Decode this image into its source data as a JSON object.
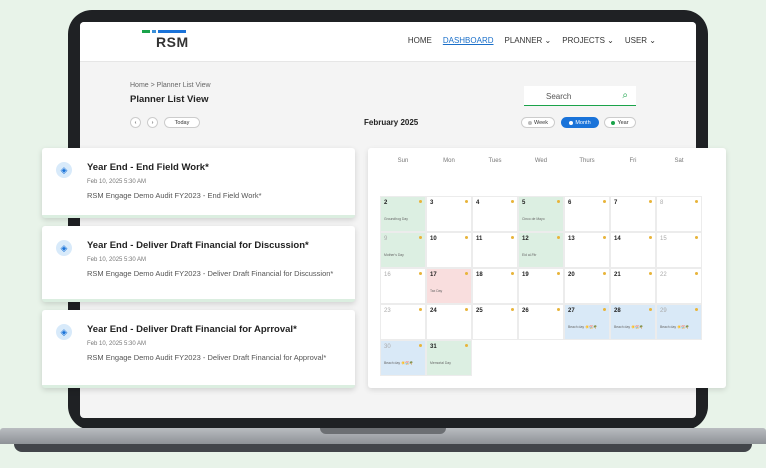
{
  "brand": {
    "name": "RSM",
    "bar_colors": [
      "#1aa34a",
      "#3a8fd8",
      "#1a73d9"
    ]
  },
  "nav": {
    "items": [
      "HOME",
      "DASHBOARD",
      "PLANNER ⌄",
      "PROJECTS ⌄",
      "USER ⌄"
    ],
    "active": "DASHBOARD"
  },
  "breadcrumb": "Home > Planner List View",
  "page_title": "Planner List View",
  "search": {
    "placeholder": "Search",
    "icon": "search-icon"
  },
  "controls": {
    "prev": "‹",
    "next": "›",
    "today": "Today",
    "month_title": "February 2025",
    "view_week": "Week",
    "view_month": "Month",
    "view_year": "Year",
    "active_view": "Month"
  },
  "calendar": {
    "day_headers": [
      "Sun",
      "Mon",
      "Tues",
      "Wed",
      "Thurs",
      "Fri",
      "Sat"
    ],
    "weeks": [
      [
        {
          "n": "2",
          "ev": "Groundhog Day",
          "c": "green",
          "m": true
        },
        {
          "n": "3",
          "m": true
        },
        {
          "n": "4",
          "m": true
        },
        {
          "n": "5",
          "ev": "Cinco de Mayo",
          "c": "green",
          "m": true
        },
        {
          "n": "6",
          "m": true
        },
        {
          "n": "7",
          "m": true
        },
        {
          "n": "8",
          "muted": true,
          "m": true
        }
      ],
      [
        {
          "n": "9",
          "ev": "Mother's Day",
          "c": "green",
          "muted": true,
          "m": true
        },
        {
          "n": "10",
          "m": true
        },
        {
          "n": "11",
          "m": true
        },
        {
          "n": "12",
          "ev": "Eid al-Fitr",
          "c": "green",
          "m": true
        },
        {
          "n": "13",
          "m": true
        },
        {
          "n": "14",
          "m": true
        },
        {
          "n": "15",
          "muted": true,
          "m": true
        }
      ],
      [
        {
          "n": "16",
          "muted": true,
          "m": true
        },
        {
          "n": "17",
          "ev": "Tax Day",
          "c": "pink",
          "m": true
        },
        {
          "n": "18",
          "m": true
        },
        {
          "n": "19",
          "m": true
        },
        {
          "n": "20",
          "m": true
        },
        {
          "n": "21",
          "m": true
        },
        {
          "n": "22",
          "muted": true,
          "m": true
        }
      ],
      [
        {
          "n": "23",
          "muted": true,
          "m": true
        },
        {
          "n": "24",
          "m": true
        },
        {
          "n": "25",
          "m": true
        },
        {
          "n": "26",
          "m": true
        },
        {
          "n": "27",
          "ev": "Beach day ☀️🏖️🌴",
          "c": "blue",
          "m": true
        },
        {
          "n": "28",
          "ev": "Beach day ☀️🏖️🌴",
          "c": "blue",
          "m": true
        },
        {
          "n": "29",
          "ev": "Beach day ☀️🏖️🌴",
          "c": "blue",
          "muted": true,
          "m": true
        }
      ],
      [
        {
          "n": "30",
          "ev": "Beach day ☀️🏖️🌴",
          "c": "blue",
          "muted": true,
          "m": true
        },
        {
          "n": "31",
          "ev": "Memorial Day",
          "c": "green",
          "m": true
        }
      ]
    ]
  },
  "cards": [
    {
      "title": "Year End - End Field Work*",
      "date": "Feb 10, 2025 5:30 AM",
      "desc": "RSM Engage Demo Audit FY2023 - End Field Work*"
    },
    {
      "title": "Year End - Deliver Draft Financial for Discussion*",
      "date": "Feb 10, 2025 5:30 AM",
      "desc": "RSM Engage Demo Audit FY2023 - Deliver Draft Financial for Discussion*"
    },
    {
      "title": "Year End -  Deliver Draft Financial for Aprroval*",
      "date": "Feb 10, 2025 5:30 AM",
      "desc": "RSM Engage Demo Audit FY2023 - Deliver Draft Financial for Approval*"
    }
  ]
}
